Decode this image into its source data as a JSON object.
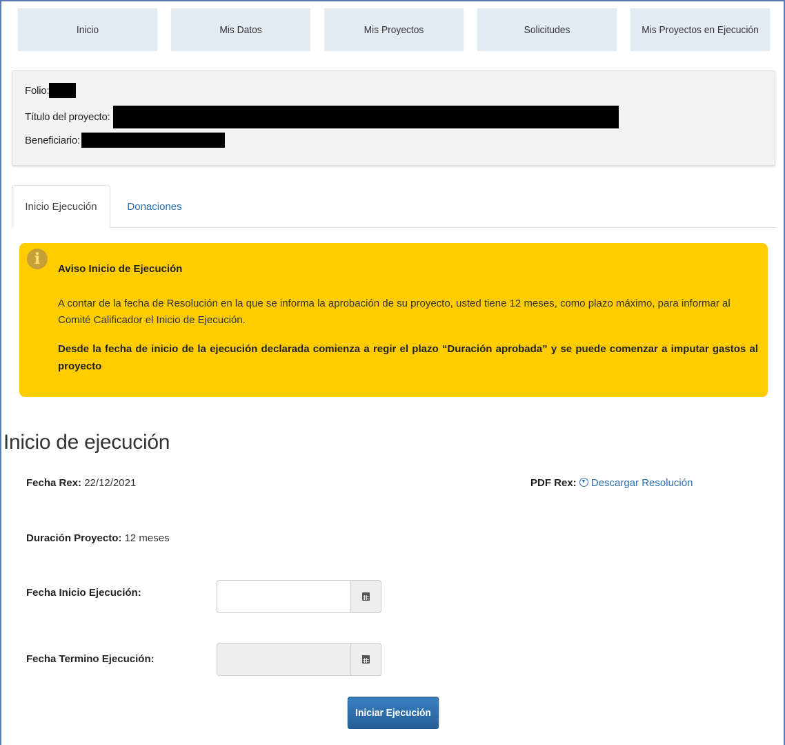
{
  "nav": {
    "items": [
      "Inicio",
      "Mis Datos",
      "Mis Proyectos",
      "Solicitudes",
      "Mis Proyectos en Ejecución"
    ]
  },
  "project": {
    "folio_label": "Folio:",
    "title_label": "Título del proyecto:",
    "beneficiary_label": "Beneficiario:"
  },
  "tabs": {
    "active": "Inicio Ejecución",
    "second": "Donaciones"
  },
  "alert": {
    "icon": "info-icon",
    "title": "Aviso Inicio de Ejecución",
    "paragraph1": "A contar de la fecha de Resolución en la que se informa la aprobación de su proyecto, usted tiene 12 meses, como plazo máximo, para informar al Comité Calificador el Inicio de Ejecución.",
    "paragraph2": "Desde la fecha de inicio de la ejecución declarada comienza a regir el plazo “Duración aprobada” y se puede comenzar a imputar gastos al proyecto",
    "color": "#ffcc00"
  },
  "section": {
    "title": "Inicio de ejecución",
    "fecha_rex_label": "Fecha Rex:",
    "fecha_rex_value": "22/12/2021",
    "pdf_rex_label": "PDF Rex:",
    "pdf_link": "Descargar Resolución",
    "duracion_label": "Duración Proyecto:",
    "duracion_value": "12 meses",
    "fecha_inicio_label": "Fecha Inicio Ejecución:",
    "fecha_inicio_value": "",
    "fecha_termino_label": "Fecha Termino Ejecución:",
    "fecha_termino_value": "",
    "submit_label": "Iniciar Ejecución"
  },
  "colors": {
    "primary": "#2a6eb0",
    "nav_bg": "#e3ebf3"
  }
}
